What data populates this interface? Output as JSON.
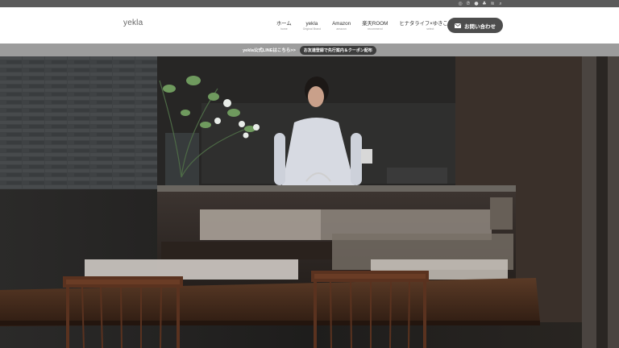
{
  "topbar": {
    "icons": [
      "instagram-icon",
      "pinterest-icon",
      "line-icon",
      "note-icon",
      "rss-icon",
      "search-icon"
    ]
  },
  "header": {
    "logo": "yekla",
    "nav": [
      {
        "label": "ホーム",
        "sub": "home"
      },
      {
        "label": "yekla",
        "sub": "Original Brand"
      },
      {
        "label": "Amazon",
        "sub": "amazon"
      },
      {
        "label": "楽天ROOM",
        "sub": "recommend"
      },
      {
        "label": "ヒナタライフ×ゆきこselect",
        "sub": "select"
      }
    ],
    "contact_label": "お問い合わせ"
  },
  "banner": {
    "text": "yekla公式LINEはこちら>>",
    "pill": "お友達登録で先行案内＆クーポン配布"
  },
  "colors": {
    "header_bg": "#ffffff",
    "topbar_bg": "#5a5a5a",
    "banner_bg": "#9c9c9c",
    "button_bg": "#4d4d4d"
  }
}
